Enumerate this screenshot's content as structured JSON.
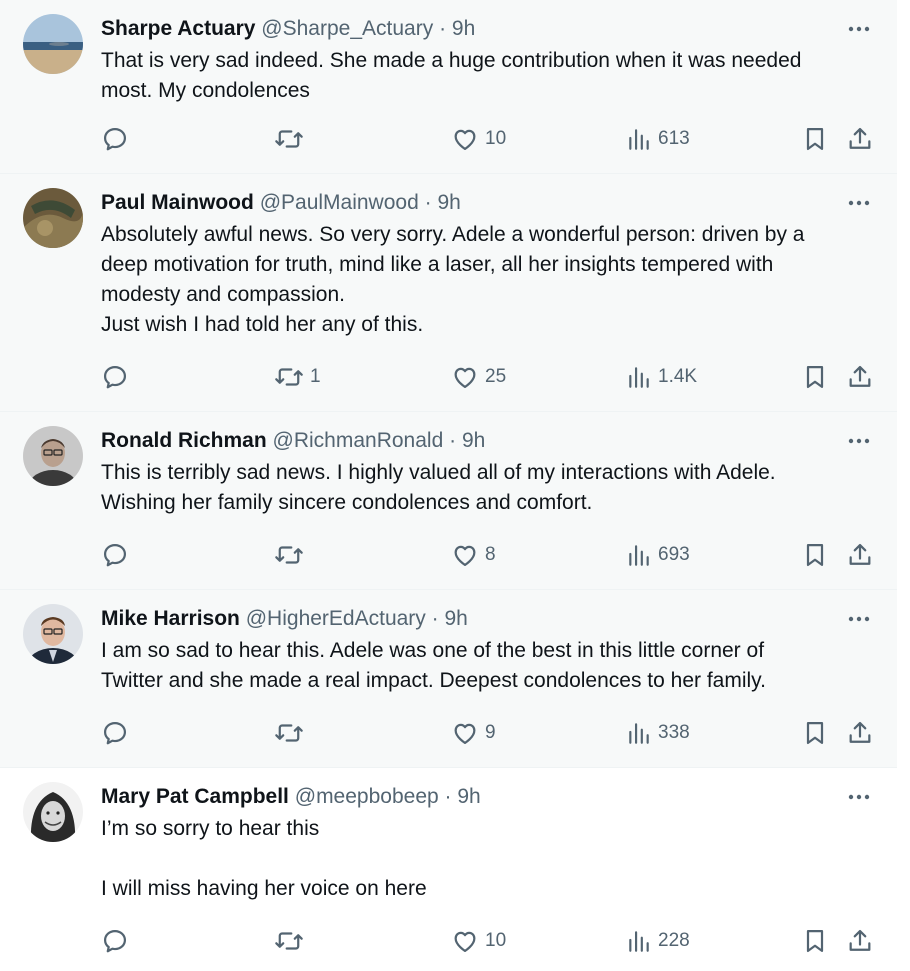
{
  "tweets": [
    {
      "name": "Sharpe Actuary",
      "handle": "@Sharpe_Actuary",
      "separator": "·",
      "time": "9h",
      "lines": [
        "That is very sad indeed. She made a huge contribution when it was needed",
        "most. My condolences"
      ],
      "replies": "",
      "retweets": "",
      "likes": "10",
      "views": "613"
    },
    {
      "name": "Paul Mainwood",
      "handle": "@PaulMainwood",
      "separator": "·",
      "time": "9h",
      "lines": [
        "Absolutely awful news. So very sorry. Adele a wonderful person: driven by a",
        "deep motivation for truth, mind like a laser, all her insights tempered with",
        "modesty and compassion.",
        "Just wish I had told her any of this."
      ],
      "replies": "",
      "retweets": "1",
      "likes": "25",
      "views": "1.4K"
    },
    {
      "name": "Ronald Richman",
      "handle": "@RichmanRonald",
      "separator": "·",
      "time": "9h",
      "lines": [
        "This is terribly sad news. I highly valued all of my interactions with Adele.",
        "Wishing her family sincere condolences and comfort."
      ],
      "replies": "",
      "retweets": "",
      "likes": "8",
      "views": "693"
    },
    {
      "name": "Mike Harrison",
      "handle": "@HigherEdActuary",
      "separator": "·",
      "time": "9h",
      "lines": [
        "I am so sad to hear this. Adele was one of the best in this little corner of",
        "Twitter and she made a real impact. Deepest condolences to her family."
      ],
      "replies": "",
      "retweets": "",
      "likes": "9",
      "views": "338"
    },
    {
      "name": "Mary Pat Campbell",
      "handle": "@meepbobeep",
      "separator": "·",
      "time": "9h",
      "lines": [
        "I’m so sorry to hear this",
        "",
        "I will miss having her voice on here"
      ],
      "replies": "",
      "retweets": "",
      "likes": "10",
      "views": "228"
    }
  ],
  "icons": {
    "reply": "reply-icon",
    "retweet": "retweet-icon",
    "like": "heart-icon",
    "views": "views-icon",
    "bookmark": "bookmark-icon",
    "share": "share-icon",
    "more": "more-icon"
  },
  "colors": {
    "text": "#0f1419",
    "muted": "#536471",
    "background": "#f7f9f9"
  }
}
